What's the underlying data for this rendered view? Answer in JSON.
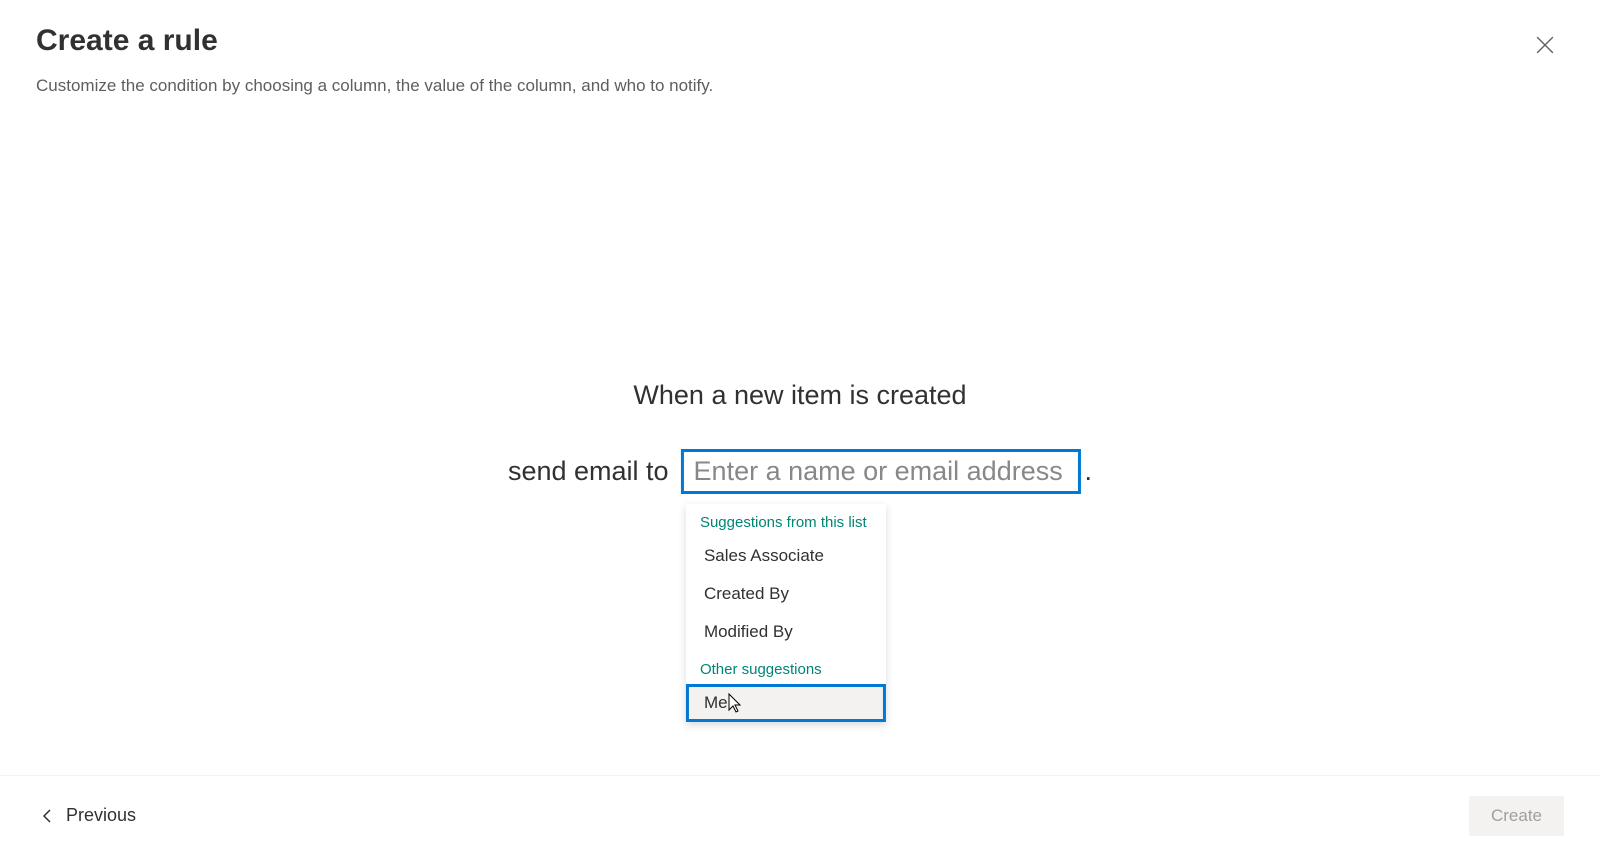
{
  "header": {
    "title": "Create a rule",
    "subtitle": "Customize the condition by choosing a column, the value of the column, and who to notify."
  },
  "content": {
    "condition": "When a new item is created",
    "send_label": "send email to",
    "input_placeholder": "Enter a name or email address",
    "period": " ."
  },
  "dropdown": {
    "header1": "Suggestions from this list",
    "items1": [
      "Sales Associate",
      "Created By",
      "Modified By"
    ],
    "header2": "Other suggestions",
    "items2": [
      "Me"
    ]
  },
  "footer": {
    "previous": "Previous",
    "create": "Create"
  }
}
